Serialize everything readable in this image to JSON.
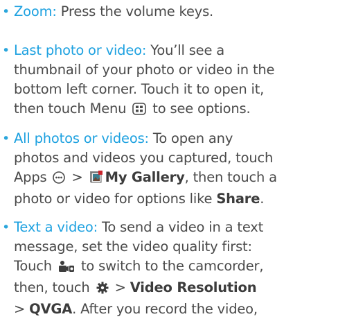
{
  "bullets": {
    "zoom": {
      "term": "Zoom:",
      "text": " Press the volume keys."
    },
    "last_photo": {
      "term": "Last photo or video:",
      "line1": " You’ll see a",
      "line2": "thumbnail of your photo or video in the",
      "line3": "bottom left corner. Touch it to open it,",
      "line4a": "then touch Menu ",
      "line4b": " to see options."
    },
    "all_photos": {
      "term": "All photos or videos:",
      "line1": " To open any",
      "line2": "photos and videos you captured, touch",
      "line3a": "Apps ",
      "line3b": " > ",
      "line3c": "My Gallery",
      "line3d": ", then touch a",
      "line4a": "photo or video for options like ",
      "line4b": "Share",
      "line4c": "."
    },
    "text_video": {
      "term": "Text a video:",
      "line1": " To send a video in a text",
      "line2": "message, set the video quality first:",
      "line3a": "Touch ",
      "line3b": " to switch to the camcorder,",
      "line4a": "then, touch ",
      "line4b": " > ",
      "line4c": "Video Resolution",
      "line5a": "> ",
      "line5b": "QVGA",
      "line5c": ". After you record the video,"
    }
  },
  "icons": {
    "menu": "menu-icon",
    "apps": "apps-icon",
    "gallery": "gallery-icon",
    "camcorder": "camcorder-switch-icon",
    "settings": "settings-gear-icon"
  },
  "colors": {
    "accent": "#1da1e0",
    "text": "#4a4a4a"
  }
}
